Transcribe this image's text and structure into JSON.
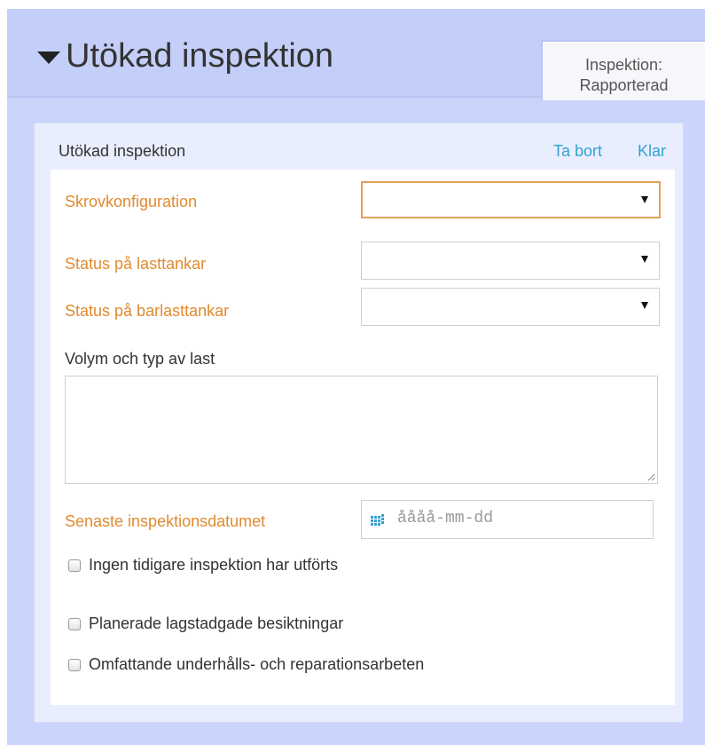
{
  "header": {
    "title": "Utökad inspektion",
    "status_line1": "Inspektion:",
    "status_line2": "Rapporterad"
  },
  "panel": {
    "title": "Utökad inspektion",
    "remove_label": "Ta bort",
    "done_label": "Klar"
  },
  "form": {
    "hull_config": {
      "label": "Skrovkonfiguration",
      "value": ""
    },
    "cargo_tanks": {
      "label": "Status på lasttankar",
      "value": ""
    },
    "ballast_tanks": {
      "label": "Status på barlasttankar",
      "value": ""
    },
    "cargo_volume": {
      "label": "Volym och typ av last",
      "value": ""
    },
    "last_inspection_date": {
      "label": "Senaste inspektionsdatumet",
      "placeholder": "åååå-mm-dd"
    },
    "checkboxes": [
      {
        "label": "Ingen tidigare inspektion har utförts",
        "checked": false
      },
      {
        "label": "Planerade lagstadgade besiktningar",
        "checked": false
      },
      {
        "label": "Omfattande underhålls- och reparationsarbeten",
        "checked": false
      }
    ]
  },
  "colors": {
    "background": "#cbd5fb",
    "required_label": "#e08a2f",
    "link": "#33a2cf",
    "focus_border": "#e0a35a"
  }
}
